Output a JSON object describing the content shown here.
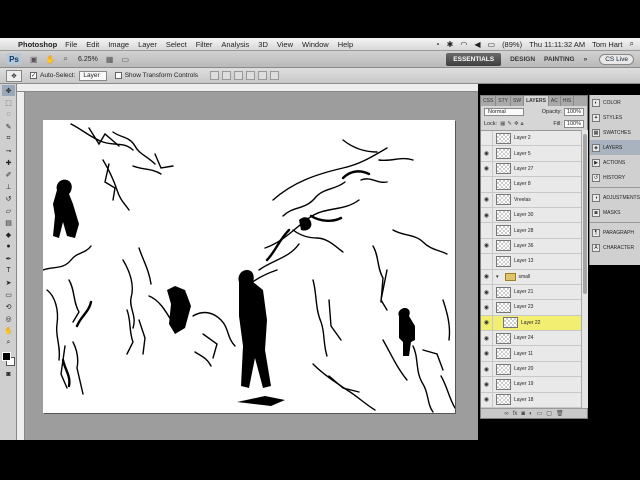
{
  "menubar": {
    "app_name": "Photoshop",
    "items": [
      "File",
      "Edit",
      "Image",
      "Layer",
      "Select",
      "Filter",
      "Analysis",
      "3D",
      "View",
      "Window",
      "Help"
    ],
    "battery": "(89%)",
    "clock": "Thu 11:11:32 AM",
    "user": "Tom Hart"
  },
  "appbar": {
    "logo": "Ps",
    "zoom": "6.25%",
    "workspace_active": "ESSENTIALS",
    "workspace_items": [
      "DESIGN",
      "PAINTING"
    ],
    "cs_live": "CS Live"
  },
  "options": {
    "auto_select_label": "Auto-Select:",
    "auto_select_value": "Layer",
    "show_transform_label": "Show Transform Controls"
  },
  "layers_panel": {
    "tabs": [
      "CSS",
      "STY",
      "SW",
      "LAYERS",
      "AC",
      "HIS"
    ],
    "blend_mode": "Normal",
    "opacity_label": "Opacity:",
    "opacity_value": "100%",
    "lock_label": "Lock:",
    "fill_label": "Fill:",
    "fill_value": "100%",
    "rows": [
      {
        "name": "Layer 2",
        "visible": false,
        "type": "layer"
      },
      {
        "name": "Layer 5",
        "visible": true,
        "type": "layer"
      },
      {
        "name": "Layer 27",
        "visible": true,
        "type": "layer"
      },
      {
        "name": "Layer 8",
        "visible": false,
        "type": "layer"
      },
      {
        "name": "Vreelas",
        "visible": true,
        "type": "layer"
      },
      {
        "name": "Layer 30",
        "visible": true,
        "type": "layer"
      },
      {
        "name": "Layer 28",
        "visible": false,
        "type": "layer"
      },
      {
        "name": "Layer 36",
        "visible": true,
        "type": "layer"
      },
      {
        "name": "Layer 13",
        "visible": false,
        "type": "layer"
      },
      {
        "name": "small",
        "visible": true,
        "type": "group"
      },
      {
        "name": "Layer 21",
        "visible": true,
        "type": "layer"
      },
      {
        "name": "Layer 23",
        "visible": true,
        "type": "layer"
      },
      {
        "name": "Layer 22",
        "visible": true,
        "type": "layer",
        "selected": true
      },
      {
        "name": "Layer 24",
        "visible": true,
        "type": "layer"
      },
      {
        "name": "Layer 11",
        "visible": true,
        "type": "layer"
      },
      {
        "name": "Layer 20",
        "visible": true,
        "type": "layer"
      },
      {
        "name": "Layer 19",
        "visible": true,
        "type": "layer"
      },
      {
        "name": "Layer 18",
        "visible": true,
        "type": "layer"
      }
    ]
  },
  "dock": {
    "groups": [
      [
        "COLOR",
        "STYLES",
        "SWATCHES",
        "LAYERS",
        "ACTIONS",
        "HISTORY"
      ],
      [
        "ADJUSTMENTS",
        "MASKS"
      ],
      [
        "PARAGRAPH",
        "CHARACTER"
      ]
    ],
    "active": "LAYERS"
  },
  "colors": {
    "selected_layer": "#f1ee72",
    "workspace_bg": "#9d9d9d",
    "foreground": "#000000",
    "background": "#ffffff"
  }
}
